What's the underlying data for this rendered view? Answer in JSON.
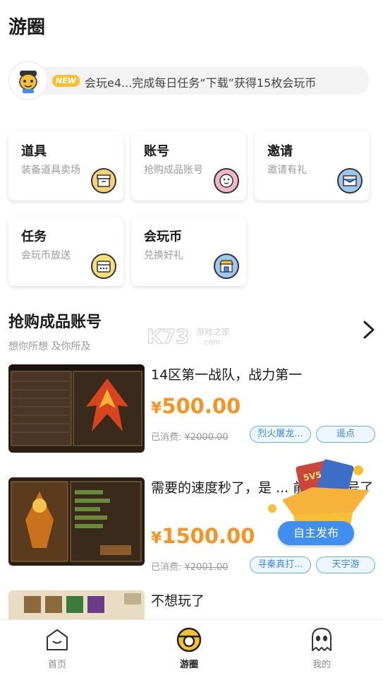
{
  "header": {
    "title": "游圈"
  },
  "notice": {
    "badge": "NEW",
    "text": "会玩e4...完成每日任务“下载”获得15枚会玩币",
    "avatar_icon": "mascot-avatar-icon"
  },
  "cards": [
    {
      "title": "道具",
      "subtitle": "装备道具卖场",
      "icon": "store-icon",
      "icon_color": "#f7d27a"
    },
    {
      "title": "账号",
      "subtitle": "抢购成品账号",
      "icon": "face-icon",
      "icon_color": "#f3b7cc"
    },
    {
      "title": "邀请",
      "subtitle": "邀请有礼",
      "icon": "mail-icon",
      "icon_color": "#9cc7ef"
    },
    {
      "title": "任务",
      "subtitle": "会玩币放送",
      "icon": "calendar-icon",
      "icon_color": "#f7e07a"
    },
    {
      "title": "会玩币",
      "subtitle": "兑换好礼",
      "icon": "shop-icon",
      "icon_color": "#9cc7ef"
    }
  ],
  "section": {
    "title": "抢购成品账号",
    "subtitle": "想你所想 及你所及",
    "watermark": "K73 游戏之家 .com"
  },
  "items": [
    {
      "title": "14区第一战队，战力第一",
      "currency": "¥",
      "price": "500.00",
      "spent_label": "已消费:",
      "spent_value": "¥2000.00",
      "tags": [
        "烈火屠龙...",
        "遥点"
      ]
    },
    {
      "title": "需要的速度秒了，是 ... 前面上错号了",
      "currency": "¥",
      "price": "1500.00",
      "spent_label": "已消费:",
      "spent_value": "¥2001.00",
      "tags": [
        "寻秦真打...",
        "天宇游"
      ]
    },
    {
      "title": "不想玩了"
    }
  ],
  "publish": {
    "label": "自主发布"
  },
  "tabbar": [
    {
      "label": "首页",
      "icon": "home-icon"
    },
    {
      "label": "游圈",
      "icon": "circle-icon"
    },
    {
      "label": "我的",
      "icon": "ghost-icon"
    }
  ],
  "colors": {
    "accent": "#f7931e",
    "brand_yellow": "#f6c033",
    "tag_blue": "#3b8ae6"
  }
}
